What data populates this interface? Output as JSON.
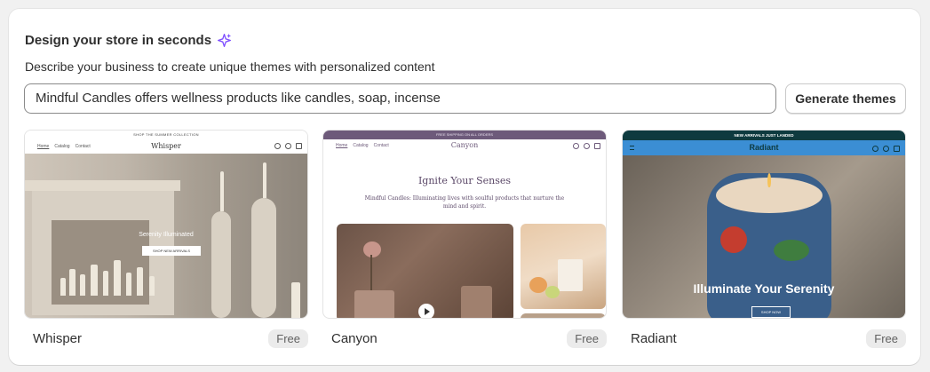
{
  "header": {
    "title": "Design your store in seconds",
    "subtitle": "Describe your business to create unique themes with personalized content"
  },
  "prompt": {
    "value": "Mindful Candles offers wellness products like candles, soap, incense"
  },
  "generate_button": {
    "label": "Generate themes"
  },
  "themes": [
    {
      "name": "Whisper",
      "price": "Free",
      "preview": {
        "announcement": "SHOP THE SUMMER COLLECTION",
        "nav_links": [
          "Home",
          "Catalog",
          "Contact"
        ],
        "logo": "Whisper",
        "hero_title": "Serenity Illuminated",
        "hero_button": "SHOP NEW ARRIVALS"
      }
    },
    {
      "name": "Canyon",
      "price": "Free",
      "preview": {
        "announcement": "FREE SHIPPING ON ALL ORDERS",
        "nav_links": [
          "Home",
          "Catalog",
          "Contact"
        ],
        "logo": "Canyon",
        "hero_title": "Ignite Your Senses",
        "hero_text": "Mindful Candles: Illuminating lives with soulful products that nurture the mind and spirit."
      }
    },
    {
      "name": "Radiant",
      "price": "Free",
      "preview": {
        "announcement": "NEW ARRIVALS JUST LANDED",
        "logo": "Radiant",
        "hero_title": "Illuminate Your Serenity",
        "hero_button": "SHOP NOW"
      }
    }
  ],
  "colors": {
    "canyon_accent": "#6d5a7a",
    "radiant_nav": "#3b8ed4",
    "radiant_announce": "#0e3a3f",
    "sparkle": "#8051ff"
  }
}
